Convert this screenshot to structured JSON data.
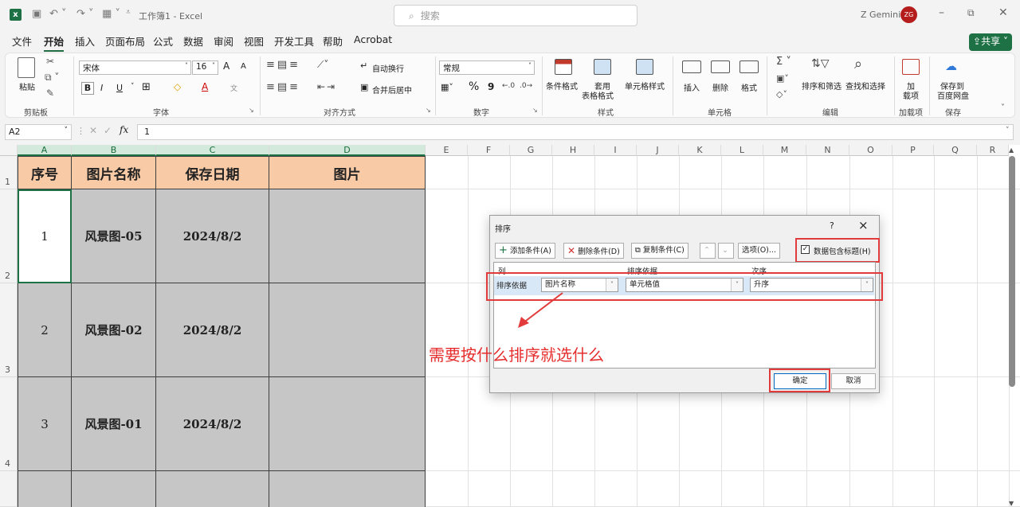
{
  "titlebar": {
    "workbook_title": "工作簿1 - Excel",
    "search_placeholder": "搜索",
    "user_name": "Z Gemini",
    "user_initials": "ZG"
  },
  "menu": {
    "file": "文件",
    "home": "开始",
    "insert": "插入",
    "page_layout": "页面布局",
    "formulas": "公式",
    "data": "数据",
    "review": "审阅",
    "view": "视图",
    "developer": "开发工具",
    "help": "帮助",
    "acrobat": "Acrobat",
    "share": "共享"
  },
  "ribbon": {
    "clipboard": {
      "paste": "粘贴",
      "group": "剪贴板"
    },
    "font": {
      "family": "宋体",
      "size": "16",
      "group": "字体",
      "bold": "B",
      "italic": "I",
      "underline": "U",
      "grow": "A",
      "shrink": "A",
      "phonetic": "文"
    },
    "alignment": {
      "wrap": "自动换行",
      "merge": "合并后居中",
      "group": "对齐方式"
    },
    "number": {
      "format": "常规",
      "percent": "%",
      "comma": "9",
      "group": "数字"
    },
    "styles": {
      "conditional": "条件格式",
      "table_1": "套用",
      "table_2": "表格格式",
      "cell_styles": "单元格样式",
      "group": "样式"
    },
    "cells": {
      "insert": "插入",
      "delete": "删除",
      "format": "格式",
      "group": "单元格"
    },
    "editing": {
      "sort_filter": "排序和筛选",
      "find_select": "查找和选择",
      "group": "编辑"
    },
    "addins": {
      "addin_1": "加",
      "addin_2": "载项",
      "group": "加载项"
    },
    "save": {
      "label_1": "保存到",
      "label_2": "百度网盘",
      "group": "保存"
    }
  },
  "formula_bar": {
    "name_box": "A2",
    "fx": "fx",
    "value": "1"
  },
  "columns": [
    "A",
    "B",
    "C",
    "D",
    "E",
    "F",
    "G",
    "H",
    "I",
    "J",
    "K",
    "L",
    "M",
    "N",
    "O",
    "P",
    "Q",
    "R"
  ],
  "rows": [
    "1",
    "2",
    "3",
    "4"
  ],
  "table": {
    "headers": [
      "序号",
      "图片名称",
      "保存日期",
      "图片"
    ],
    "rows": [
      [
        "1",
        "风景图-05",
        "2024/8/2",
        ""
      ],
      [
        "2",
        "风景图-02",
        "2024/8/2",
        ""
      ],
      [
        "3",
        "风景图-01",
        "2024/8/2",
        ""
      ]
    ]
  },
  "dialog": {
    "title": "排序",
    "help": "?",
    "close": "×",
    "add_level": "添加条件(A)",
    "delete_level": "删除条件(D)",
    "copy_level": "复制条件(C)",
    "options": "选项(O)...",
    "has_headers": "数据包含标题(H)",
    "has_headers_checked": true,
    "col_header": "列",
    "sort_on_header": "排序依据",
    "order_header": "次序",
    "row_label": "排序依据",
    "column_value": "图片名称",
    "sort_on_value": "单元格值",
    "order_value": "升序",
    "ok": "确定",
    "cancel": "取消"
  },
  "annotation": {
    "text": "需要按什么排序就选什么",
    "color": "#e62d2d"
  },
  "colors": {
    "accent": "#1e7145",
    "header_fill": "#f8cba6",
    "data_fill": "#c6c6c6",
    "highlight": "#e23b3b"
  }
}
